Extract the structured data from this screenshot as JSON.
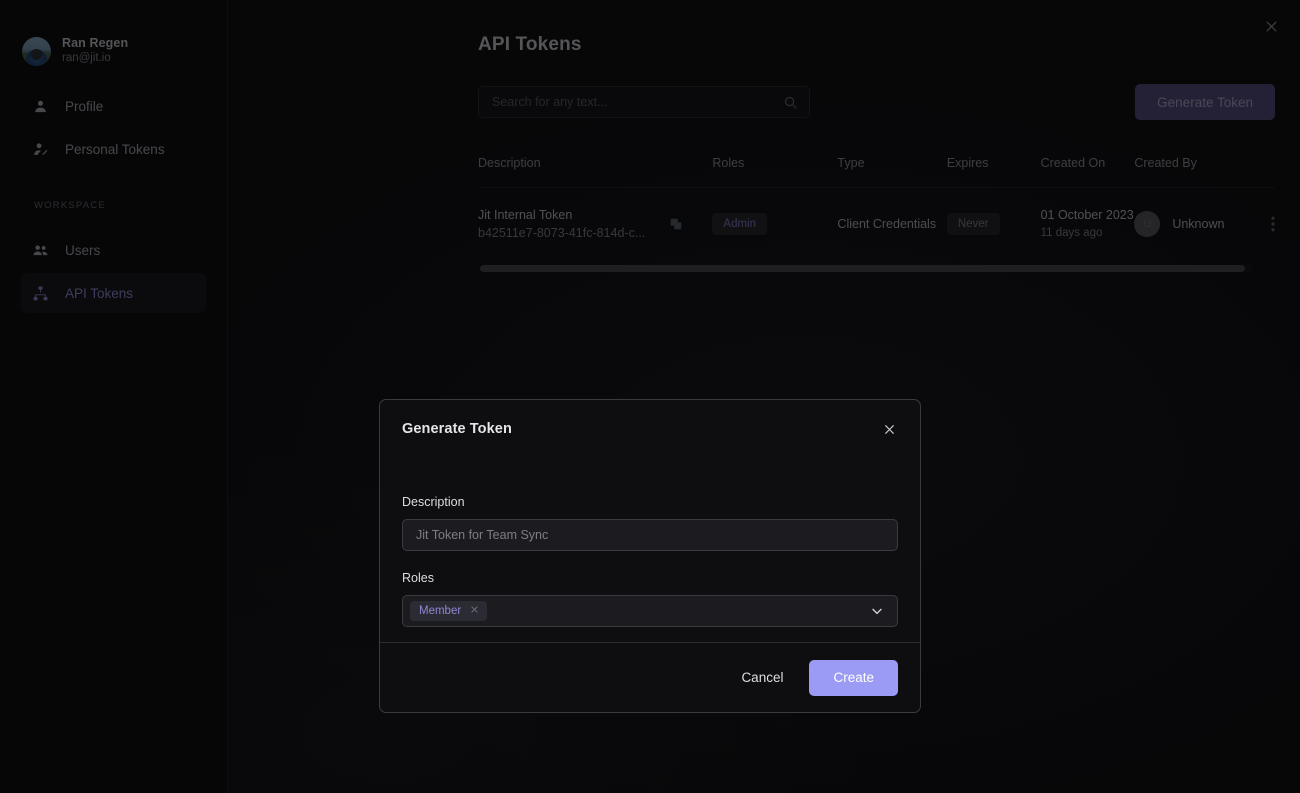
{
  "sidebar": {
    "user": {
      "name": "Ran Regen",
      "email": "ran@jit.io",
      "avatar_icon": "user-photo-avatar"
    },
    "items": [
      {
        "label": "Profile",
        "icon": "person-icon",
        "active": false
      },
      {
        "label": "Personal Tokens",
        "icon": "person-edit-icon",
        "active": false
      }
    ],
    "section_label": "WORKSPACE",
    "workspace_items": [
      {
        "label": "Users",
        "icon": "people-icon",
        "active": false
      },
      {
        "label": "API Tokens",
        "icon": "sitemap-icon",
        "active": true
      }
    ]
  },
  "header": {
    "title": "API Tokens",
    "close_icon": "close-icon"
  },
  "toolbar": {
    "search_placeholder": "Search for any text...",
    "search_value": "",
    "search_icon": "search-icon",
    "generate_label": "Generate Token"
  },
  "table": {
    "columns": [
      "Description",
      "Roles",
      "Type",
      "Expires",
      "Created On",
      "Created By"
    ],
    "rows": [
      {
        "description": "Jit Internal Token",
        "token_id": "b42511e7-8073-41fc-814d-c...",
        "copy_icon": "copy-icon",
        "role": "Admin",
        "type": "Client Credentials",
        "expires": "Never",
        "created_on": "01 October 2023",
        "created_ago": "11 days ago",
        "created_by": "Unknown",
        "created_by_initial": "U",
        "menu_icon": "kebab-menu-icon"
      }
    ]
  },
  "modal": {
    "title": "Generate Token",
    "close_icon": "close-icon",
    "description_label": "Description",
    "description_placeholder": "Jit Token for Team Sync",
    "description_value": "",
    "roles_label": "Roles",
    "roles_selected": [
      {
        "label": "Member",
        "remove_icon": "remove-chip-icon"
      }
    ],
    "dropdown_icon": "chevron-down-icon",
    "cancel_label": "Cancel",
    "create_label": "Create"
  },
  "colors": {
    "accent": "#9b9bf5",
    "accent_dim": "#575085",
    "chip_purple_text": "#8d88d4",
    "sidebar_bg": "#08080a",
    "page_bg": "#0b0b0d",
    "modal_bg": "#0e0e11"
  }
}
